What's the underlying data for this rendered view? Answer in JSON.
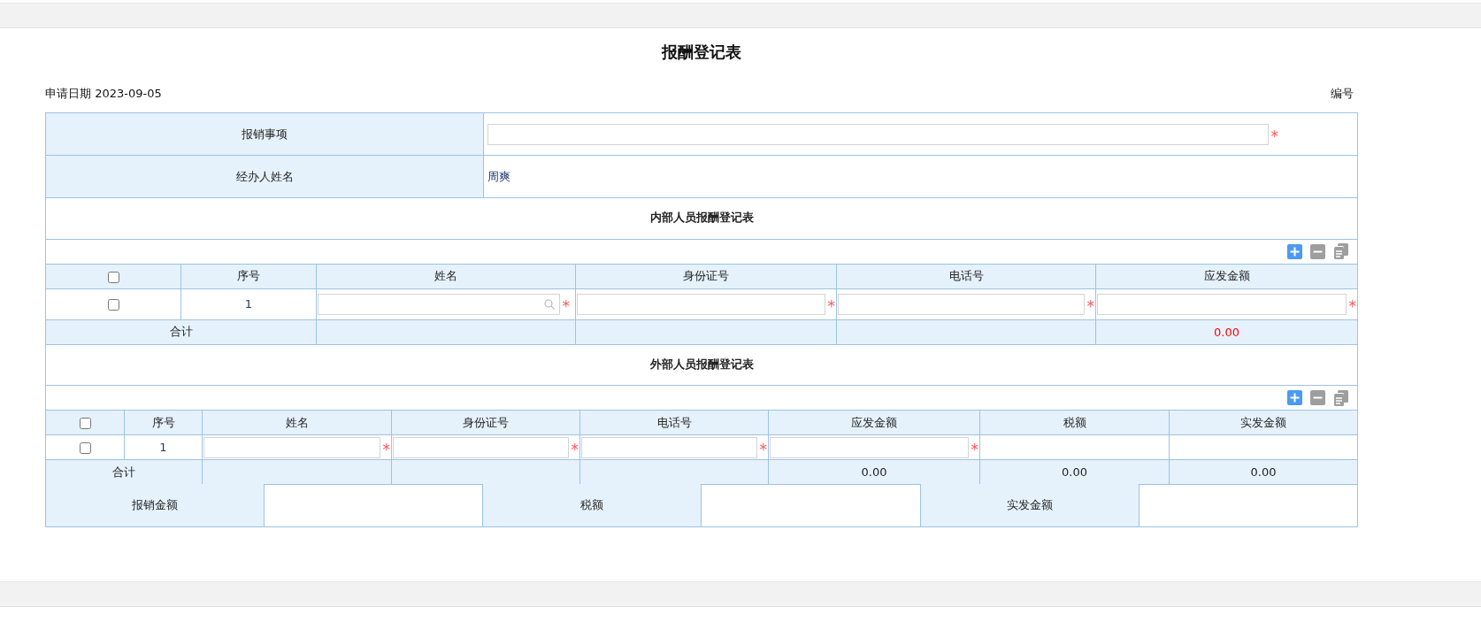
{
  "title": "报酬登记表",
  "apply_date": {
    "label": "申请日期",
    "value": "2023-09-05"
  },
  "number": {
    "label": "编号"
  },
  "fields": [
    {
      "label": "报销事项",
      "kind": "input",
      "required_mark": "*"
    },
    {
      "label": "经办人姓名",
      "kind": "text",
      "value": "周爽"
    }
  ],
  "internal": {
    "title": "内部人员报酬登记表",
    "columns": [
      {
        "kind": "checkbox",
        "checked": false
      },
      {
        "label": "序号"
      },
      {
        "label": "姓名"
      },
      {
        "label": "身份证号"
      },
      {
        "label": "电话号"
      },
      {
        "label": "应发金额"
      }
    ],
    "rows": [
      {
        "cells": [
          {
            "kind": "checkbox",
            "checked": false
          },
          {
            "kind": "index",
            "text": "1"
          },
          {
            "kind": "lookup",
            "required_mark": "*"
          },
          {
            "kind": "input",
            "required_mark": "*"
          },
          {
            "kind": "input",
            "required_mark": "*"
          },
          {
            "kind": "input",
            "required_mark": "*"
          }
        ]
      }
    ],
    "total": {
      "label": "合计",
      "cells": [
        {},
        {},
        {},
        {
          "value": "0.00",
          "alert": true
        }
      ]
    }
  },
  "external": {
    "title": "外部人员报酬登记表",
    "columns": [
      {
        "kind": "checkbox",
        "checked": false
      },
      {
        "label": "序号"
      },
      {
        "label": "姓名"
      },
      {
        "label": "身份证号"
      },
      {
        "label": "电话号"
      },
      {
        "label": "应发金额"
      },
      {
        "label": "税额"
      },
      {
        "label": "实发金额"
      }
    ],
    "rows": [
      {
        "cells": [
          {
            "kind": "checkbox",
            "checked": false
          },
          {
            "kind": "index",
            "text": "1"
          },
          {
            "kind": "input",
            "required_mark": "*"
          },
          {
            "kind": "input",
            "required_mark": "*"
          },
          {
            "kind": "input",
            "required_mark": "*"
          },
          {
            "kind": "input",
            "required_mark": "*"
          },
          {
            "kind": "empty"
          },
          {
            "kind": "empty"
          }
        ]
      }
    ],
    "total": {
      "label": "合计",
      "cells": [
        {},
        {},
        {},
        {
          "value": "0.00",
          "alert": false
        },
        {
          "value": "0.00",
          "alert": false
        },
        {
          "value": "0.00",
          "alert": false
        }
      ]
    }
  },
  "summary": [
    {
      "label": "报销金额"
    },
    {
      "label": "税额"
    },
    {
      "label": "实发金额"
    }
  ]
}
